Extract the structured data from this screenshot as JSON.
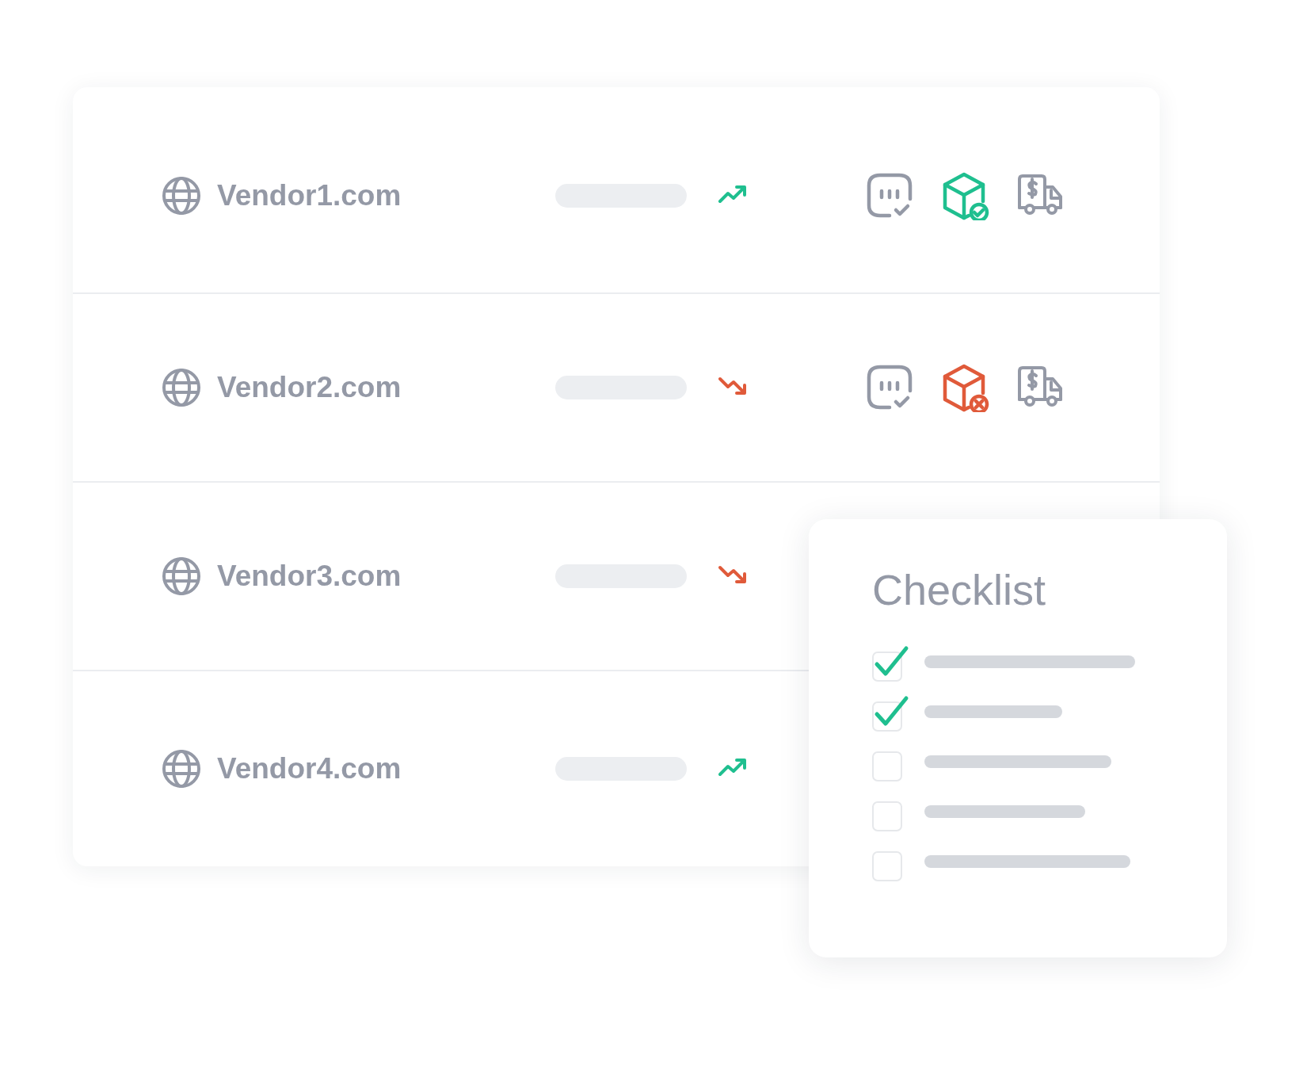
{
  "vendors": [
    {
      "name": "Vendor1.com",
      "trending_up": true,
      "shipment_ok": true
    },
    {
      "name": "Vendor2.com",
      "trending_up": false,
      "shipment_ok": false
    },
    {
      "name": "Vendor3.com",
      "trending_up": false
    },
    {
      "name": "Vendor4.com",
      "trending_up": true
    }
  ],
  "checklist": {
    "title": "Checklist",
    "items": [
      {
        "checked": true
      },
      {
        "checked": true
      },
      {
        "checked": false
      },
      {
        "checked": false
      },
      {
        "checked": false
      }
    ]
  }
}
